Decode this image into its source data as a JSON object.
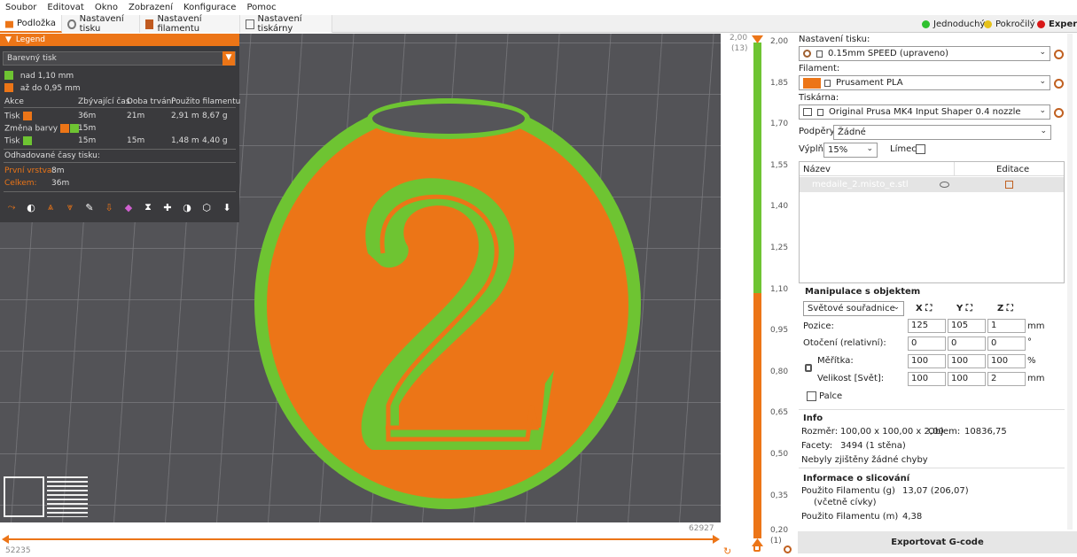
{
  "menu": [
    "Soubor",
    "Editovat",
    "Okno",
    "Zobrazení",
    "Konfigurace",
    "Pomoc"
  ],
  "tabs": [
    "Podložka",
    "Nastavení tisku",
    "Nastavení filamentu",
    "Nastavení tiskárny"
  ],
  "modes": {
    "simple": "Jednoduchý",
    "advanced": "Pokročilý",
    "expert": "Expert"
  },
  "legend": {
    "title": "Legend",
    "view_type": "Barevný tisk",
    "ranges": [
      {
        "label": "nad 1,10 mm",
        "color": "#6ec432"
      },
      {
        "label": "až do 0,95 mm",
        "color": "#ec7517"
      }
    ],
    "headers": {
      "action": "Akce",
      "remaining": "Zbývající čas",
      "duration": "Doba trvání",
      "used": "Použito filamentu"
    },
    "rows": [
      {
        "action": "Tisk",
        "remaining": "36m",
        "duration": "21m",
        "used_m": "2,91 m",
        "used_g": "8,67 g"
      },
      {
        "action": "Změna barvy",
        "remaining": "15m",
        "duration": "",
        "used_m": "",
        "used_g": ""
      },
      {
        "action": "Tisk",
        "remaining": "15m",
        "duration": "15m",
        "used_m": "1,48 m",
        "used_g": "4,40 g"
      }
    ],
    "est_title": "Odhadované časy tisku:",
    "first_layer_label": "První vrstva:",
    "first_layer": "8m",
    "total_label": "Celkem:",
    "total": "36m"
  },
  "slider": {
    "top_value": "2,00",
    "top_layer": "(13)",
    "bottom_value": "0,20",
    "bottom_layer": "(1)",
    "ticks": [
      "2,00",
      "1,85",
      "1,70",
      "1,55",
      "1,40",
      "1,25",
      "1,10",
      "0,95",
      "0,80",
      "0,65",
      "0,50",
      "0,35",
      "0,20"
    ]
  },
  "hslider": {
    "left": "52235",
    "right": "62927"
  },
  "right": {
    "print_label": "Nastavení tisku:",
    "print_value": "0.15mm SPEED (upraveno)",
    "filament_label": "Filament:",
    "filament_value": "Prusament PLA",
    "filament_color": "#ec7517",
    "printer_label": "Tiskárna:",
    "printer_value": "Original Prusa MK4 Input Shaper 0.4 nozzle",
    "supports_label": "Podpěry:",
    "supports_value": "Žádné",
    "infill_label": "Výplň:",
    "infill_value": "15%",
    "brim_label": "Límec:",
    "list_name": "Název",
    "list_edit": "Editace",
    "object_name": "medaile_2.misto_e.stl",
    "manip_title": "Manipulace s objektem",
    "coord_value": "Světové souřadnice",
    "axes": [
      "X",
      "Y",
      "Z"
    ],
    "pos_label": "Pozice:",
    "pos": [
      "125",
      "105",
      "1"
    ],
    "pos_unit": "mm",
    "rot_label": "Otočení (relativní):",
    "rot": [
      "0",
      "0",
      "0"
    ],
    "rot_unit": "°",
    "scale_label": "Měřítka:",
    "scale": [
      "100",
      "100",
      "100"
    ],
    "scale_unit": "%",
    "size_label": "Velikost [Svět]:",
    "size": [
      "100",
      "100",
      "2"
    ],
    "size_unit": "mm",
    "inches_label": "Palce",
    "info_title": "Info",
    "size_info_label": "Rozměr:",
    "size_info": "100,00 x 100,00 x 2,00",
    "volume_label": "Objem:",
    "volume": "10836,75",
    "facets_label": "Facety:",
    "facets": "3494 (1 stěna)",
    "errors": "Nebyly zjištěny žádné chyby",
    "slice_title": "Informace o slicování",
    "fil_g_label": "Použito Filamentu (g)",
    "fil_g_sub": "(včetně cívky)",
    "fil_g": "13,07 (206,07)",
    "fil_m_label": "Použito Filamentu (m)",
    "fil_m": "4,38",
    "export": "Exportovat G-code"
  }
}
